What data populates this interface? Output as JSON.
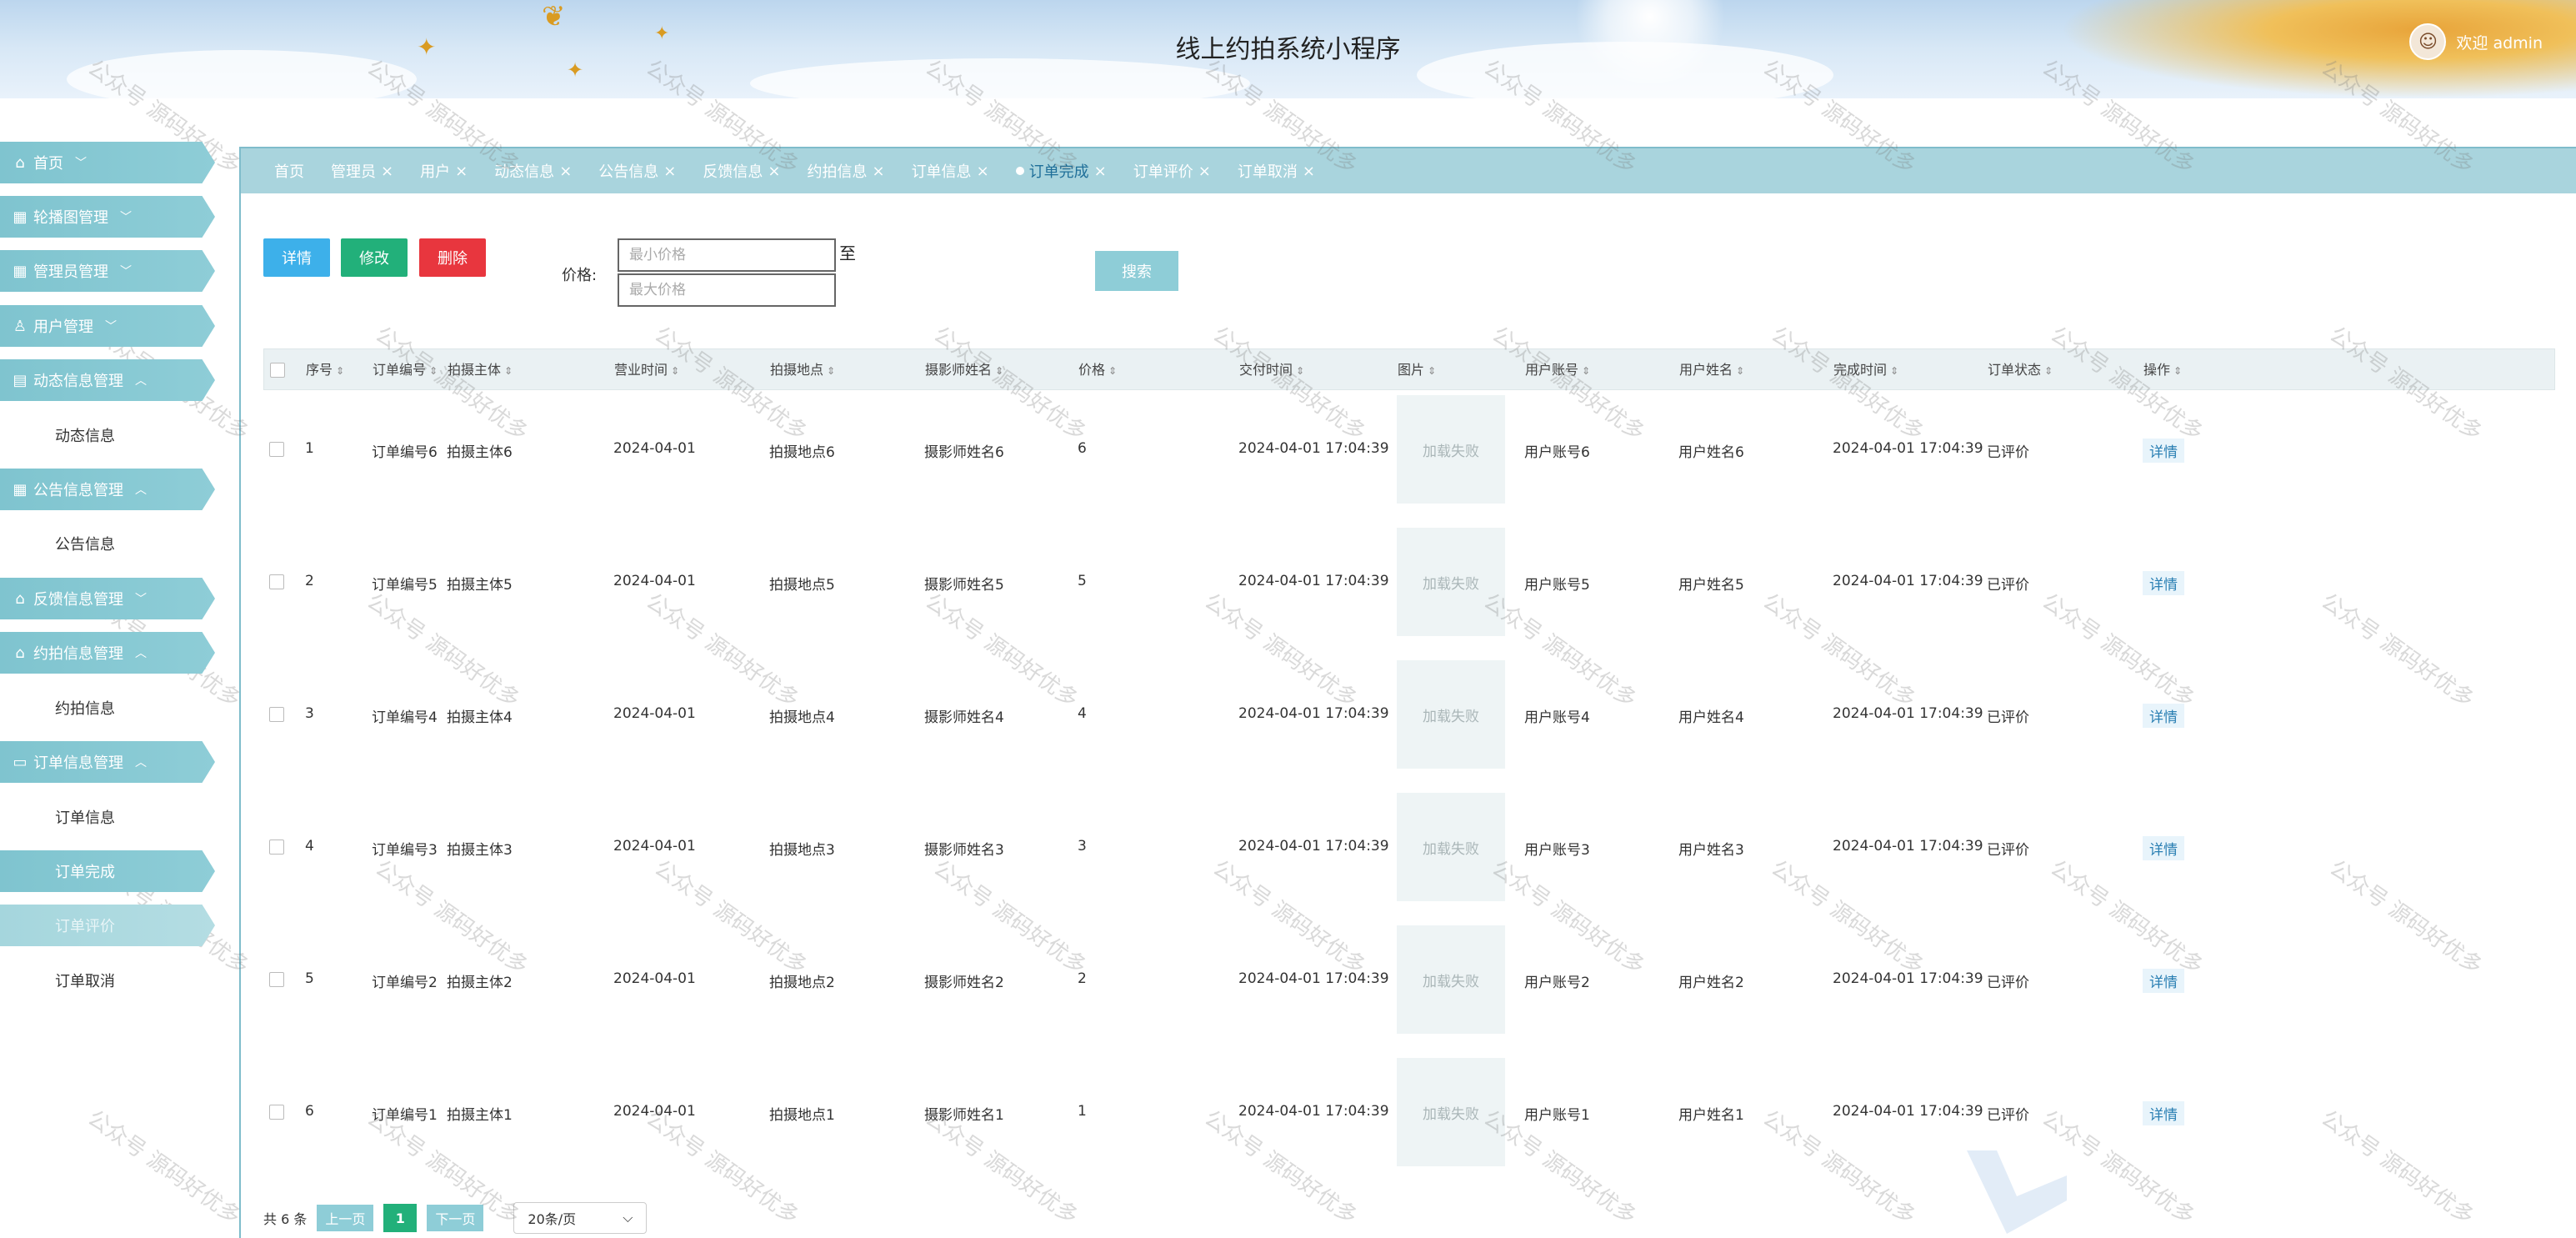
{
  "header": {
    "title": "线上约拍系统小程序",
    "welcome": "欢迎 admin"
  },
  "sidebar": {
    "items": [
      {
        "label": "首页",
        "icon": "home-icon",
        "chevron": "﹀"
      },
      {
        "label": "轮播图管理",
        "icon": "grid-icon",
        "chevron": "﹀"
      },
      {
        "label": "管理员管理",
        "icon": "grid-icon",
        "chevron": "﹀"
      },
      {
        "label": "用户管理",
        "icon": "user-icon",
        "chevron": "﹀"
      },
      {
        "label": "动态信息管理",
        "icon": "doc-icon",
        "chevron": "︿"
      },
      {
        "label": "动态信息",
        "sub": true
      },
      {
        "label": "公告信息管理",
        "icon": "grid-icon",
        "chevron": "︿"
      },
      {
        "label": "公告信息",
        "sub": true
      },
      {
        "label": "反馈信息管理",
        "icon": "house-icon",
        "chevron": "﹀"
      },
      {
        "label": "约拍信息管理",
        "icon": "house-icon",
        "chevron": "︿"
      },
      {
        "label": "约拍信息",
        "sub": true
      },
      {
        "label": "订单信息管理",
        "icon": "folder-icon",
        "chevron": "︿"
      },
      {
        "label": "订单信息",
        "sub": true
      },
      {
        "label": "订单完成",
        "sub": true,
        "state": "active"
      },
      {
        "label": "订单评价",
        "sub": true,
        "state": "hover"
      },
      {
        "label": "订单取消",
        "sub": true
      }
    ]
  },
  "tabs": [
    {
      "label": "首页"
    },
    {
      "label": "管理员"
    },
    {
      "label": "用户"
    },
    {
      "label": "动态信息"
    },
    {
      "label": "公告信息"
    },
    {
      "label": "反馈信息"
    },
    {
      "label": "约拍信息"
    },
    {
      "label": "订单信息"
    },
    {
      "label": "订单完成",
      "active": true
    },
    {
      "label": "订单评价"
    },
    {
      "label": "订单取消"
    }
  ],
  "toolbar": {
    "detail": "详情",
    "edit": "修改",
    "delete": "删除",
    "price_label": "价格:",
    "min_price_placeholder": "最小价格",
    "max_price_placeholder": "最大价格",
    "to": "至",
    "search": "搜索"
  },
  "table": {
    "columns": [
      "序号",
      "订单编号",
      "拍摄主体",
      "营业时间",
      "拍摄地点",
      "摄影师姓名",
      "价格",
      "交付时间",
      "图片",
      "用户账号",
      "用户姓名",
      "完成时间",
      "订单状态",
      "操作"
    ],
    "rows": [
      {
        "no": "1",
        "order": "订单编号6",
        "subject": "拍摄主体6",
        "date": "2024-04-01",
        "place": "拍摄地点6",
        "photographer": "摄影师姓名6",
        "price": "6",
        "delivered": "2024-04-01 17:04:39",
        "image": "加载失败",
        "account": "用户账号6",
        "name": "用户姓名6",
        "done": "2024-04-01 17:04:39",
        "status": "已评价",
        "action": "详情"
      },
      {
        "no": "2",
        "order": "订单编号5",
        "subject": "拍摄主体5",
        "date": "2024-04-01",
        "place": "拍摄地点5",
        "photographer": "摄影师姓名5",
        "price": "5",
        "delivered": "2024-04-01 17:04:39",
        "image": "加载失败",
        "account": "用户账号5",
        "name": "用户姓名5",
        "done": "2024-04-01 17:04:39",
        "status": "已评价",
        "action": "详情"
      },
      {
        "no": "3",
        "order": "订单编号4",
        "subject": "拍摄主体4",
        "date": "2024-04-01",
        "place": "拍摄地点4",
        "photographer": "摄影师姓名4",
        "price": "4",
        "delivered": "2024-04-01 17:04:39",
        "image": "加载失败",
        "account": "用户账号4",
        "name": "用户姓名4",
        "done": "2024-04-01 17:04:39",
        "status": "已评价",
        "action": "详情"
      },
      {
        "no": "4",
        "order": "订单编号3",
        "subject": "拍摄主体3",
        "date": "2024-04-01",
        "place": "拍摄地点3",
        "photographer": "摄影师姓名3",
        "price": "3",
        "delivered": "2024-04-01 17:04:39",
        "image": "加载失败",
        "account": "用户账号3",
        "name": "用户姓名3",
        "done": "2024-04-01 17:04:39",
        "status": "已评价",
        "action": "详情"
      },
      {
        "no": "5",
        "order": "订单编号2",
        "subject": "拍摄主体2",
        "date": "2024-04-01",
        "place": "拍摄地点2",
        "photographer": "摄影师姓名2",
        "price": "2",
        "delivered": "2024-04-01 17:04:39",
        "image": "加载失败",
        "account": "用户账号2",
        "name": "用户姓名2",
        "done": "2024-04-01 17:04:39",
        "status": "已评价",
        "action": "详情"
      },
      {
        "no": "6",
        "order": "订单编号1",
        "subject": "拍摄主体1",
        "date": "2024-04-01",
        "place": "拍摄地点1",
        "photographer": "摄影师姓名1",
        "price": "1",
        "delivered": "2024-04-01 17:04:39",
        "image": "加载失败",
        "account": "用户账号1",
        "name": "用户姓名1",
        "done": "2024-04-01 17:04:39",
        "status": "已评价",
        "action": "详情"
      }
    ]
  },
  "pager": {
    "total": "共 6 条",
    "prev": "上一页",
    "page": "1",
    "next": "下一页",
    "size": "20条/页"
  },
  "watermark": "公众号 源码好优多",
  "colors": {
    "accent": "#8ecdd7",
    "tab_bg": "#a9d4dd",
    "detail_btn": "#3db0ea",
    "edit_btn": "#22b07a",
    "delete_btn": "#e8363e"
  }
}
